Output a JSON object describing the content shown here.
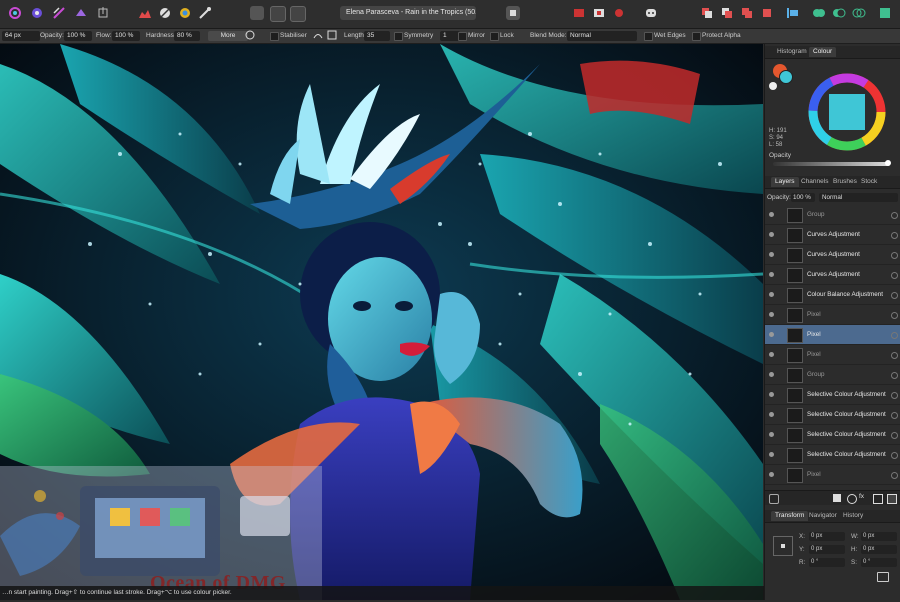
{
  "document": {
    "title": "Elena Parasceva - Rain in the Tropics (50.1% ▾"
  },
  "context_bar": {
    "size": "64 px",
    "opacity_label": "Opacity:",
    "opacity_value": "100 %",
    "flow_label": "Flow:",
    "flow_value": "100 %",
    "hardness_label": "Hardness:",
    "hardness_value": "80 %",
    "more_label": "More",
    "stabiliser_label": "Stabiliser",
    "length_label": "Length",
    "length_value": "35",
    "symmetry_label": "Symmetry",
    "symmetry_value": "1",
    "mirror_label": "Mirror",
    "lock_label": "Lock",
    "blend_mode_label": "Blend Mode:",
    "blend_mode_value": "Normal",
    "wet_edges_label": "Wet Edges",
    "protect_alpha_label": "Protect Alpha"
  },
  "status": {
    "text": "…n start painting. Drag+⇧ to continue last stroke. Drag+⌥ to use colour picker."
  },
  "watermark": {
    "text": "Ocean of DMG"
  },
  "colour_panel": {
    "tabs": [
      "Histogram",
      "Colour"
    ],
    "active_tab": "Colour",
    "h_value": "H: 191",
    "s_value": "S: 94",
    "l_value": "L: 58",
    "opacity_label": "Opacity",
    "swatch_color": "#3fc6d6"
  },
  "layers_panel": {
    "tabs": [
      "Layers",
      "Channels",
      "Brushes",
      "Stock"
    ],
    "active_tab": "Layers",
    "opacity_label": "Opacity:",
    "opacity_value": "100 %",
    "blend_value": "Normal",
    "layers": [
      {
        "name": "Group",
        "dim": true
      },
      {
        "name": "Curves Adjustment",
        "dim": false
      },
      {
        "name": "Curves Adjustment",
        "dim": false
      },
      {
        "name": "Curves Adjustment",
        "dim": false
      },
      {
        "name": "Colour Balance Adjustment",
        "dim": false
      },
      {
        "name": "Pixel",
        "dim": true
      },
      {
        "name": "Pixel",
        "dim": false,
        "selected": true
      },
      {
        "name": "Pixel",
        "dim": true
      },
      {
        "name": "Group",
        "dim": true
      },
      {
        "name": "Selective Colour Adjustment",
        "dim": false
      },
      {
        "name": "Selective Colour Adjustment",
        "dim": false
      },
      {
        "name": "Selective Colour Adjustment",
        "dim": false
      },
      {
        "name": "Selective Colour Adjustment",
        "dim": false
      },
      {
        "name": "Pixel",
        "dim": true
      }
    ]
  },
  "transform_panel": {
    "tabs": [
      "Transform",
      "Navigator",
      "History"
    ],
    "active_tab": "Transform",
    "x_label": "X:",
    "x_value": "0 px",
    "y_label": "Y:",
    "y_value": "0 px",
    "w_label": "W:",
    "w_value": "0 px",
    "h_label": "H:",
    "h_value": "0 px",
    "r_label": "R:",
    "r_value": "0 °",
    "s_label": "S:",
    "s_value": "0 °"
  },
  "colors": {
    "selection": "#4c6a8f",
    "accent": "#3fc6d6"
  }
}
